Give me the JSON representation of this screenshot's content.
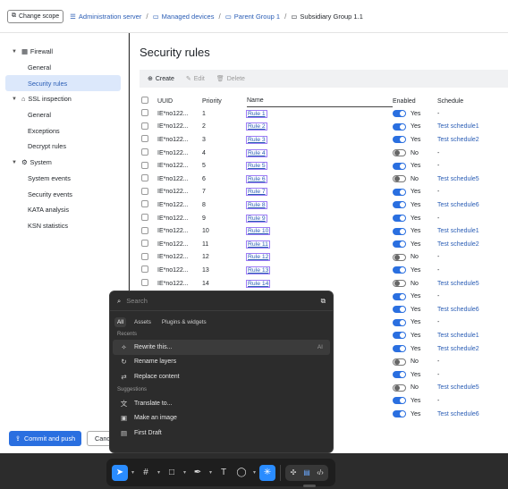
{
  "topbar": {
    "change_scope": "Change scope",
    "breadcrumbs": [
      "Administration server",
      "Managed devices",
      "Parent Group 1"
    ],
    "current": "Subsidiary Group 1.1"
  },
  "sidebar": {
    "groups": [
      {
        "label": "Firewall",
        "icon": "firewall-icon",
        "items": [
          "General",
          "Security rules"
        ]
      },
      {
        "label": "SSL inspection",
        "icon": "lock-icon",
        "items": [
          "General",
          "Exceptions",
          "Decrypt rules"
        ]
      },
      {
        "label": "System",
        "icon": "system-icon",
        "items": [
          "System events",
          "Security events",
          "KATA analysis",
          "KSN statistics"
        ]
      }
    ],
    "active_item": "Security rules"
  },
  "main": {
    "title": "Security rules",
    "toolbar": {
      "create": "Create",
      "edit": "Edit",
      "delete": "Delete"
    },
    "columns": {
      "uuid": "UUID",
      "priority": "Priority",
      "name": "Name",
      "enabled": "Enabled",
      "schedule": "Schedule"
    },
    "rows": [
      {
        "uuid": "IE*no122...",
        "priority": "1",
        "name": "Rule 1",
        "enabled": "Yes",
        "schedule": "-"
      },
      {
        "uuid": "IE*no122...",
        "priority": "2",
        "name": "Rule 2",
        "enabled": "Yes",
        "schedule": "Test schedule1"
      },
      {
        "uuid": "IE*no122...",
        "priority": "3",
        "name": "Rule 3",
        "enabled": "Yes",
        "schedule": "Test schedule2"
      },
      {
        "uuid": "IE*no122...",
        "priority": "4",
        "name": "Rule 4",
        "enabled": "No",
        "schedule": "-"
      },
      {
        "uuid": "IE*no122...",
        "priority": "5",
        "name": "Rule 5",
        "enabled": "Yes",
        "schedule": "-"
      },
      {
        "uuid": "IE*no122...",
        "priority": "6",
        "name": "Rule 6",
        "enabled": "No",
        "schedule": "Test schedule5"
      },
      {
        "uuid": "IE*no122...",
        "priority": "7",
        "name": "Rule 7",
        "enabled": "Yes",
        "schedule": "-"
      },
      {
        "uuid": "IE*no122...",
        "priority": "8",
        "name": "Rule 8",
        "enabled": "Yes",
        "schedule": "Test schedule6"
      },
      {
        "uuid": "IE*no122...",
        "priority": "9",
        "name": "Rule 9",
        "enabled": "Yes",
        "schedule": "-"
      },
      {
        "uuid": "IE*no122...",
        "priority": "10",
        "name": "Rule 10",
        "enabled": "Yes",
        "schedule": "Test schedule1"
      },
      {
        "uuid": "IE*no122...",
        "priority": "11",
        "name": "Rule 11",
        "enabled": "Yes",
        "schedule": "Test schedule2"
      },
      {
        "uuid": "IE*no122...",
        "priority": "12",
        "name": "Rule 12",
        "enabled": "No",
        "schedule": "-"
      },
      {
        "uuid": "IE*no122...",
        "priority": "13",
        "name": "Rule 13",
        "enabled": "Yes",
        "schedule": "-"
      },
      {
        "uuid": "IE*no122...",
        "priority": "14",
        "name": "Rule 14",
        "enabled": "No",
        "schedule": "Test schedule5"
      },
      {
        "uuid": "",
        "priority": "",
        "name": "",
        "enabled": "Yes",
        "schedule": "-"
      },
      {
        "uuid": "",
        "priority": "",
        "name": "",
        "enabled": "Yes",
        "schedule": "Test schedule6"
      },
      {
        "uuid": "",
        "priority": "",
        "name": "",
        "enabled": "Yes",
        "schedule": "-"
      },
      {
        "uuid": "",
        "priority": "",
        "name": "",
        "enabled": "Yes",
        "schedule": "Test schedule1"
      },
      {
        "uuid": "",
        "priority": "",
        "name": "",
        "enabled": "Yes",
        "schedule": "Test schedule2"
      },
      {
        "uuid": "",
        "priority": "",
        "name": "",
        "enabled": "No",
        "schedule": "-"
      },
      {
        "uuid": "",
        "priority": "",
        "name": "",
        "enabled": "Yes",
        "schedule": "-"
      },
      {
        "uuid": "",
        "priority": "",
        "name": "",
        "enabled": "No",
        "schedule": "Test schedule5"
      },
      {
        "uuid": "",
        "priority": "",
        "name": "",
        "enabled": "Yes",
        "schedule": "-"
      },
      {
        "uuid": "",
        "priority": "",
        "name": "",
        "enabled": "Yes",
        "schedule": "Test schedule6"
      }
    ],
    "commit_button": "Commit and push",
    "cancel_button": "Cancel"
  },
  "palette": {
    "search_placeholder": "Search",
    "tabs": [
      "All",
      "Assets",
      "Plugins & widgets"
    ],
    "recents_label": "Recents",
    "recents": [
      {
        "label": "Rewrite this...",
        "icon": "rewrite-icon",
        "tag": "AI"
      },
      {
        "label": "Rename layers",
        "icon": "rename-icon",
        "tag": ""
      },
      {
        "label": "Replace content",
        "icon": "replace-icon",
        "tag": ""
      }
    ],
    "suggestions_label": "Suggestions",
    "suggestions": [
      {
        "label": "Translate to...",
        "icon": "translate-icon"
      },
      {
        "label": "Make an image",
        "icon": "image-icon"
      },
      {
        "label": "First Draft",
        "icon": "draft-icon"
      }
    ]
  },
  "colors": {
    "accent": "#2a6fe0",
    "link": "#2a5db5",
    "toggle_on": "#2a6fe0",
    "dock_selected": "#2a8cff"
  }
}
